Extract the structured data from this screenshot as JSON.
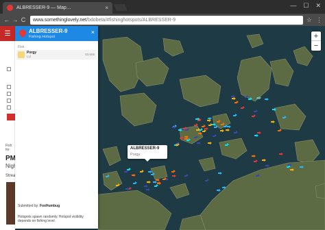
{
  "browser": {
    "tab_title": "ALBRESSER-9 — Map…",
    "tab_close": "×",
    "url_host": "www.somethinglovely.net",
    "url_path": "/bdobeta/#fishinghotspots/ALBRESSER-9",
    "back": "←",
    "forward": "→",
    "reload": "C",
    "window_controls": [
      "—",
      "☐",
      "✕"
    ]
  },
  "popup": {
    "title": "ALBRESSER-9",
    "subtitle": "Fishing Hotspot",
    "close": "×",
    "section_label": "Fish",
    "fish": [
      {
        "name": "Porgy",
        "level": "Lvl",
        "value": "53,605"
      }
    ],
    "submitted_label": "Submitted by:",
    "submitted_by": "FoxHumbug",
    "note": "Hotspots spawn randomly. Hotspot visibility depends on fishing level."
  },
  "sidebar": {
    "menu_icon": "☰",
    "heading": "PM",
    "subheading": "Nigh",
    "stream_label": "Strea",
    "fish_label": "Fish for"
  },
  "tooltip": {
    "title": "ALBRESSER-9",
    "fish": "Porgy"
  },
  "map": {
    "zoom_in": "+",
    "zoom_out": "−",
    "water_color": "#1e3a44",
    "land_color": "#6b7a4a"
  }
}
